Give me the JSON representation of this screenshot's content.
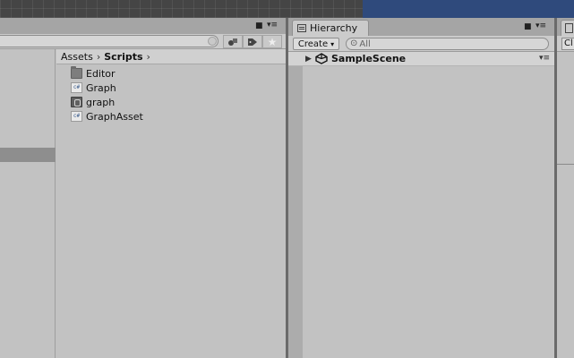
{
  "project": {
    "breadcrumb": [
      "Assets",
      "Scripts"
    ],
    "items": [
      {
        "label": "Editor",
        "icon": "folder-icon"
      },
      {
        "label": "Graph",
        "icon": "csharp-script-icon"
      },
      {
        "label": "graph",
        "icon": "asset-file-icon"
      },
      {
        "label": "GraphAsset",
        "icon": "csharp-script-icon"
      }
    ],
    "cs_glyph": "c#"
  },
  "hierarchy": {
    "tab_label": "Hierarchy",
    "create_label": "Create",
    "search_placeholder": "All",
    "scene_name": "SampleScene"
  },
  "inspector": {
    "clipped_text": "Cl"
  },
  "glyphs": {
    "lock": "🔒",
    "menu": "▾≡",
    "breadcrumb_sep": "›",
    "expand_arrow": "▶",
    "dropdown": "▾",
    "search": "⊙"
  },
  "colors": {
    "panel_bg": "#c2c2c2",
    "title_blue": "#2f4a7c",
    "selection": "#8e8e8e"
  }
}
